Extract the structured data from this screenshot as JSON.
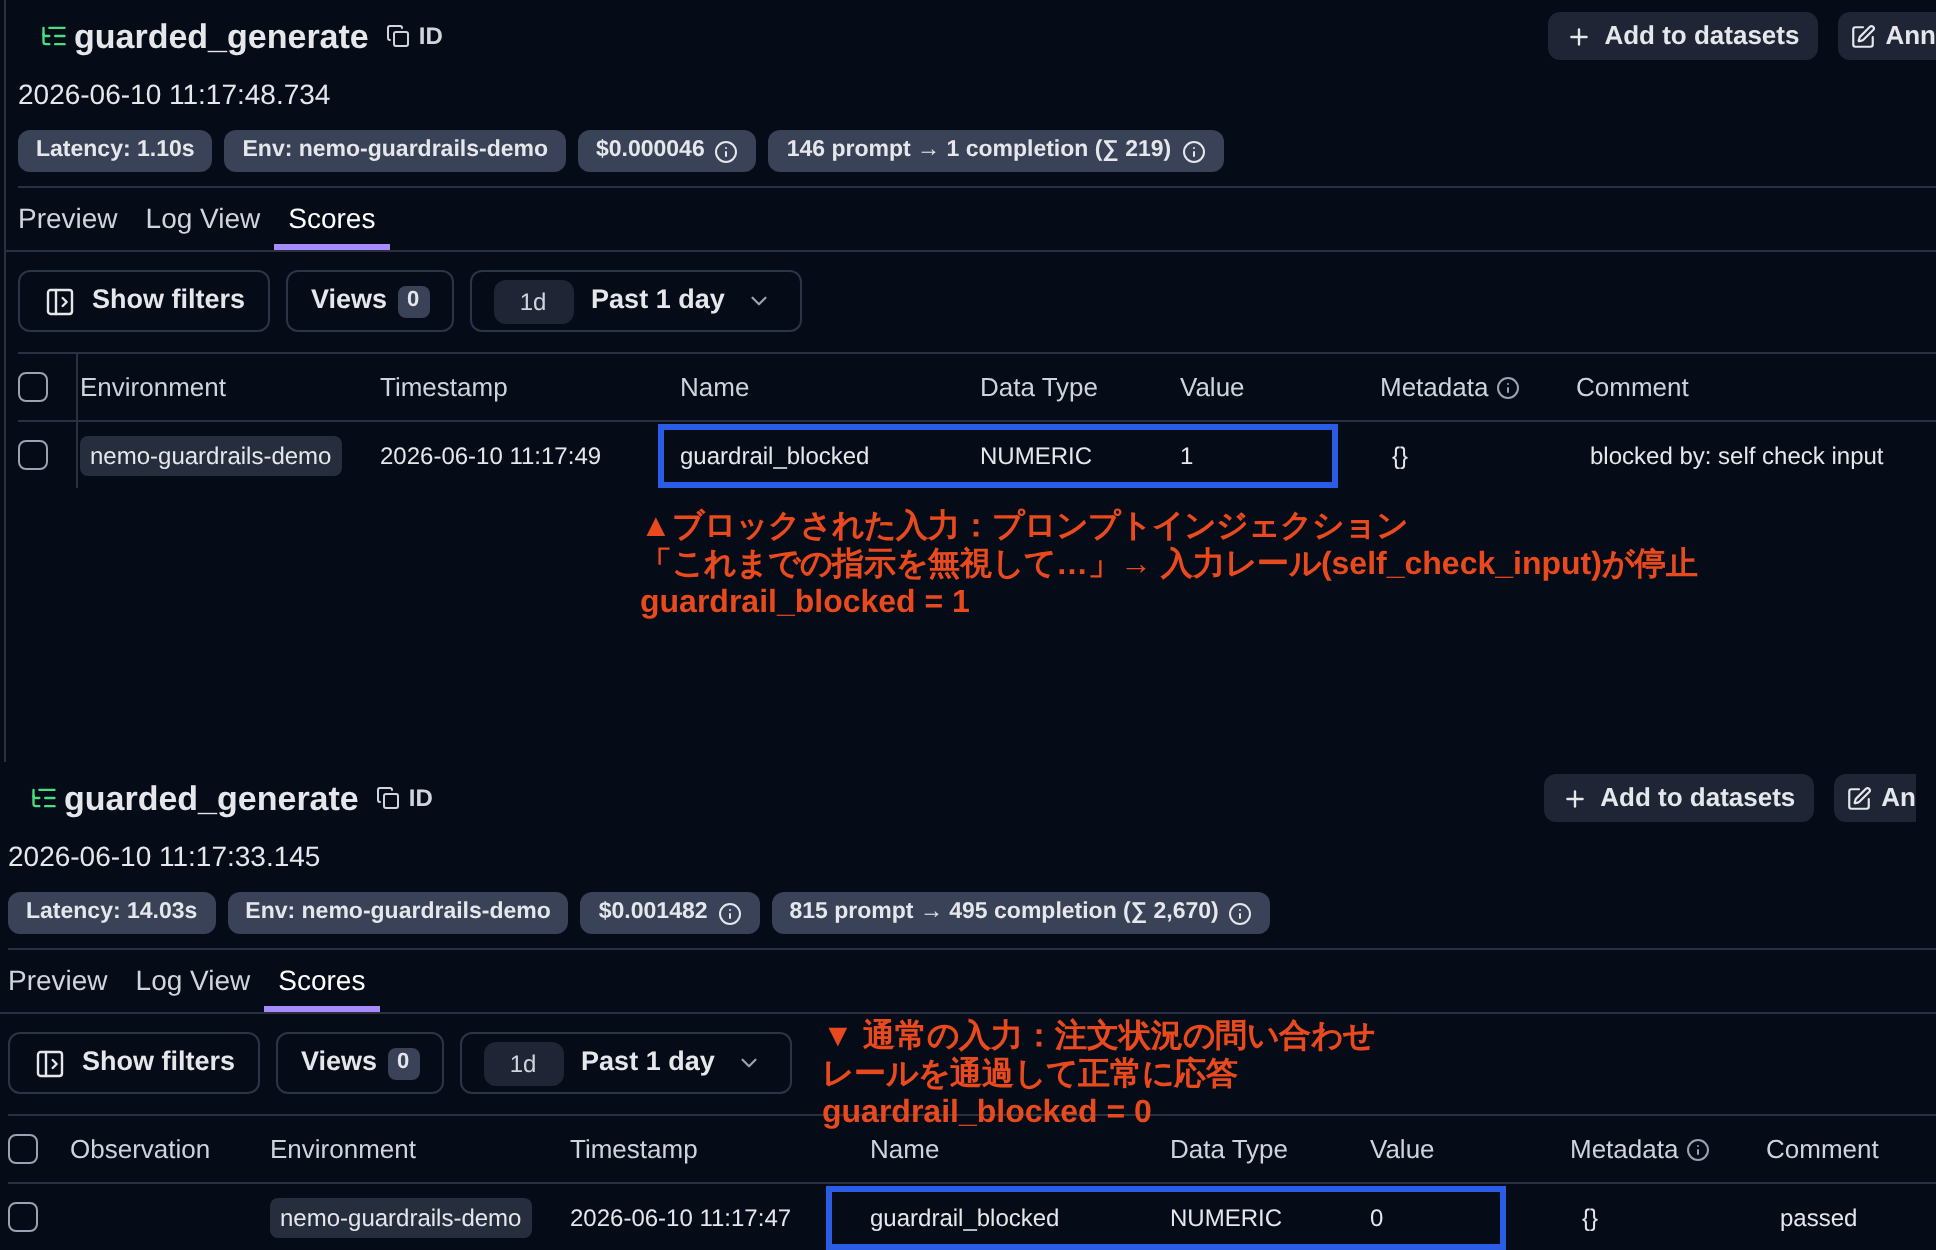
{
  "panels": [
    {
      "title": "guarded_generate",
      "copy_label": "ID",
      "actions": [
        {
          "kind": "add",
          "label": "Add to datasets"
        },
        {
          "kind": "annotate",
          "label": "Ann"
        }
      ],
      "timestamp": "2026-06-10 11:17:48.734",
      "badges": [
        {
          "label": "Latency: 1.10s",
          "info": false
        },
        {
          "label": "Env: nemo-guardrails-demo",
          "info": false
        },
        {
          "label": "$0.000046",
          "info": true
        },
        {
          "label": "146 prompt → 1 completion (∑ 219)",
          "info": true
        }
      ],
      "tabs": [
        {
          "label": "Preview",
          "selected": false
        },
        {
          "label": "Log View",
          "selected": false
        },
        {
          "label": "Scores",
          "selected": true
        }
      ],
      "toolbar": {
        "filters": "Show filters",
        "views": {
          "label": "Views",
          "count": "0"
        },
        "range": {
          "chip": "1d",
          "label": "Past 1 day"
        }
      },
      "table": {
        "all_checked": false,
        "columns": [
          {
            "kind": "environment",
            "label": "Environment",
            "info": false
          },
          {
            "kind": "timestamp",
            "label": "Timestamp",
            "info": false
          },
          {
            "kind": "name",
            "label": "Name",
            "info": false
          },
          {
            "kind": "data_type",
            "label": "Data Type",
            "info": false
          },
          {
            "kind": "value",
            "label": "Value",
            "info": false
          },
          {
            "kind": "metadata",
            "label": "Metadata",
            "info": true
          },
          {
            "kind": "comment",
            "label": "Comment",
            "info": false
          }
        ],
        "rows": [
          {
            "checked": false,
            "cells": [
              {
                "kind": "tag",
                "text": "nemo-guardrails-demo",
                "framed": false
              },
              {
                "kind": "text",
                "text": "2026-06-10 11:17:49",
                "framed": false
              },
              {
                "kind": "text",
                "text": "guardrail_blocked",
                "framed": true
              },
              {
                "kind": "text",
                "text": "NUMERIC",
                "framed": true
              },
              {
                "kind": "text",
                "text": "1",
                "framed": true
              },
              {
                "kind": "text",
                "text": "{}",
                "framed": false
              },
              {
                "kind": "text",
                "text": "blocked by: self check input",
                "framed": false
              }
            ]
          }
        ]
      },
      "annotation": [
        "▲ブロックされた入力：プロンプトインジェクション",
        "「これまでの指示を無視して…」→ 入力レール(self_check_input)が停止",
        "guardrail_blocked = 1"
      ]
    },
    {
      "title": "guarded_generate",
      "copy_label": "ID",
      "actions": [
        {
          "kind": "add",
          "label": "Add to datasets"
        },
        {
          "kind": "annotate",
          "label": "An"
        }
      ],
      "timestamp": "2026-06-10 11:17:33.145",
      "badges": [
        {
          "label": "Latency: 14.03s",
          "info": false
        },
        {
          "label": "Env: nemo-guardrails-demo",
          "info": false
        },
        {
          "label": "$0.001482",
          "info": true
        },
        {
          "label": "815 prompt → 495 completion (∑ 2,670)",
          "info": true
        }
      ],
      "tabs": [
        {
          "label": "Preview",
          "selected": false
        },
        {
          "label": "Log View",
          "selected": false
        },
        {
          "label": "Scores",
          "selected": true
        }
      ],
      "toolbar": {
        "filters": "Show filters",
        "views": {
          "label": "Views",
          "count": "0"
        },
        "range": {
          "chip": "1d",
          "label": "Past 1 day"
        }
      },
      "table": {
        "all_checked": false,
        "columns": [
          {
            "kind": "observation",
            "label": "Observation",
            "info": false
          },
          {
            "kind": "environment",
            "label": "Environment",
            "info": false
          },
          {
            "kind": "timestamp",
            "label": "Timestamp",
            "info": false
          },
          {
            "kind": "name",
            "label": "Name",
            "info": false
          },
          {
            "kind": "data_type",
            "label": "Data Type",
            "info": false
          },
          {
            "kind": "value",
            "label": "Value",
            "info": false
          },
          {
            "kind": "metadata",
            "label": "Metadata",
            "info": true
          },
          {
            "kind": "comment",
            "label": "Comment",
            "info": false
          }
        ],
        "rows": [
          {
            "checked": false,
            "cells": [
              {
                "kind": "blank",
                "framed": false
              },
              {
                "kind": "tag",
                "text": "nemo-guardrails-demo",
                "framed": false
              },
              {
                "kind": "text",
                "text": "2026-06-10 11:17:47",
                "framed": false
              },
              {
                "kind": "text",
                "text": "guardrail_blocked",
                "framed": true
              },
              {
                "kind": "text",
                "text": "NUMERIC",
                "framed": true
              },
              {
                "kind": "text",
                "text": "0",
                "framed": true
              },
              {
                "kind": "text",
                "text": "{}",
                "framed": false
              },
              {
                "kind": "text",
                "text": "passed",
                "framed": false
              }
            ]
          }
        ]
      },
      "annotation": [
        "▼ 通常の入力：注文状況の問い合わせ",
        "レールを通過して正常に応答",
        "guardrail_blocked = 0"
      ]
    }
  ]
}
